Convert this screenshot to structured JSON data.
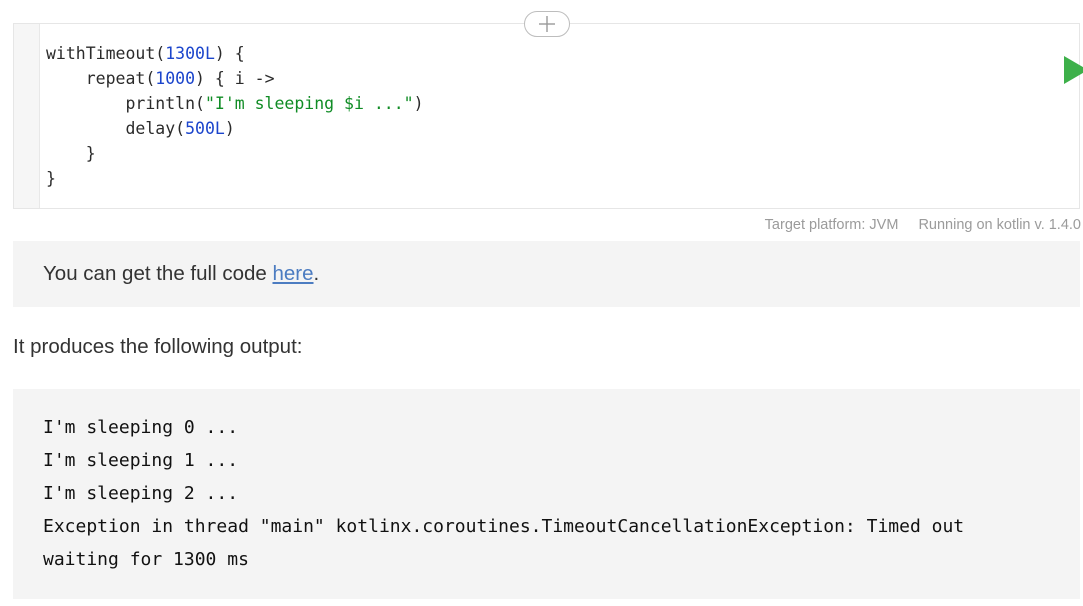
{
  "editor": {
    "code_lines": [
      [
        {
          "t": "withTimeout(",
          "c": ""
        },
        {
          "t": "1300L",
          "c": "num"
        },
        {
          "t": ") {",
          "c": ""
        }
      ],
      [
        {
          "t": "    repeat(",
          "c": ""
        },
        {
          "t": "1000",
          "c": "num"
        },
        {
          "t": ") { i ->",
          "c": ""
        }
      ],
      [
        {
          "t": "        println(",
          "c": ""
        },
        {
          "t": "\"I'm sleeping $i ...\"",
          "c": "str"
        },
        {
          "t": ")",
          "c": ""
        }
      ],
      [
        {
          "t": "        delay(",
          "c": ""
        },
        {
          "t": "500L",
          "c": "num"
        },
        {
          "t": ")",
          "c": ""
        }
      ],
      [
        {
          "t": "    }",
          "c": ""
        }
      ],
      [
        {
          "t": "}",
          "c": ""
        }
      ]
    ],
    "add_icon": "plus-icon",
    "run_icon": "play-icon",
    "run_color": "#3db04a"
  },
  "platform": {
    "target": "Target platform: JVM",
    "version": "Running on kotlin v. 1.4.0"
  },
  "note": {
    "prefix": "You can get the full code ",
    "link": "here",
    "suffix": "."
  },
  "paragraph": "It produces the following output:",
  "output": {
    "lines": [
      "I'm sleeping 0 ...",
      "I'm sleeping 1 ...",
      "I'm sleeping 2 ...",
      "Exception in thread \"main\" kotlinx.coroutines.TimeoutCancellationException: Timed out",
      "waiting for 1300 ms"
    ]
  }
}
